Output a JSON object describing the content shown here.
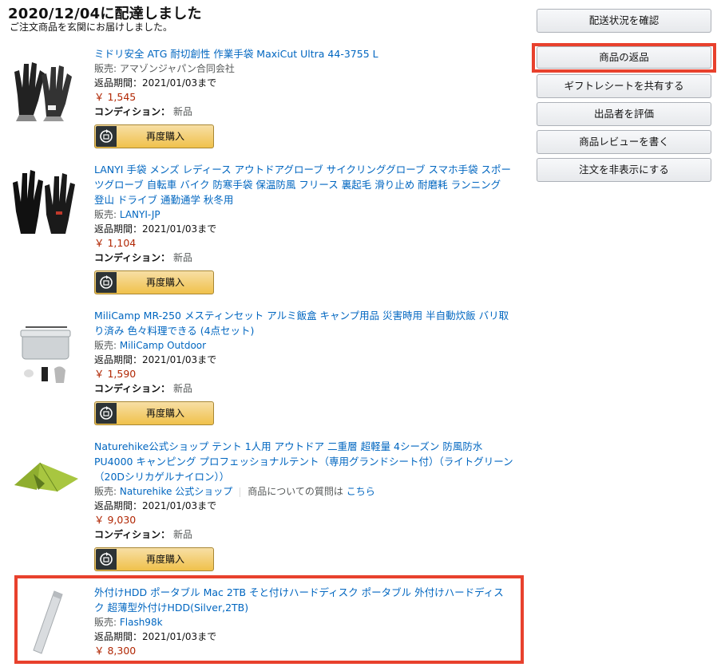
{
  "header": {
    "title": "2020/12/04に配達しました",
    "subtitle": "ご注文商品を玄関にお届けしました。"
  },
  "sidebar": {
    "buttons": [
      "配送状況を確認",
      "商品の返品",
      "ギフトレシートを共有する",
      "出品者を評価",
      "商品レビューを書く",
      "注文を非表示にする"
    ]
  },
  "labels": {
    "seller_prefix": "販売: ",
    "condition_label": "コンディション：",
    "buy_again": "再度購入",
    "question_text": "商品についての質問は",
    "question_link": "こちら"
  },
  "items": [
    {
      "title": "ミドリ安全 ATG 耐切創性 作業手袋 MaxiCut Ultra 44-3755 L",
      "seller": "アマゾンジャパン合同会社",
      "return_period": "返品期間：2021/01/03まで",
      "price": "￥ 1,545",
      "condition": "新品"
    },
    {
      "title": "LANYI 手袋 メンズ レディース アウトドアグローブ サイクリンググローブ スマホ手袋 スポーツグローブ 自転車 バイク 防寒手袋 保温防風 フリース 裏起毛 滑り止め 耐磨耗 ランニング 登山 ドライブ 通勤通学 秋冬用",
      "seller": "LANYI-JP",
      "return_period": "返品期間：2021/01/03まで",
      "price": "￥ 1,104",
      "condition": "新品"
    },
    {
      "title": "MiliCamp MR-250 メスティンセット アルミ飯盒 キャンプ用品 災害時用 半自動炊飯 バリ取り済み 色々料理できる (4点セット)",
      "seller": "MiliCamp Outdoor",
      "return_period": "返品期間：2021/01/03まで",
      "price": "￥ 1,590",
      "condition": "新品"
    },
    {
      "title": "Naturehike公式ショップ テント 1人用 アウトドア 二重層 超軽量 4シーズン 防風防水 PU4000 キャンピング プロフェッショナルテント（専用グランドシート付）（ライトグリーン（20Dシリカゲルナイロン））",
      "seller": "Naturehike 公式ショップ",
      "return_period": "返品期間：2021/01/03まで",
      "price": "￥ 9,030",
      "condition": "新品"
    },
    {
      "title": "外付けHDD ポータブル Mac 2TB そと付けハードディスク ポータブル 外付けハードディスク 超薄型外付けHDD(Silver,2TB)",
      "seller": "Flash98k",
      "return_period": "返品期間：2021/01/03まで",
      "price": "￥ 8,300"
    }
  ],
  "icons": {
    "buy_again_icon": "cart-refresh-icon"
  },
  "colors": {
    "link": "#0066c0",
    "price": "#b12704",
    "highlight": "#e8412d",
    "buy_button": "#f0c14b"
  }
}
